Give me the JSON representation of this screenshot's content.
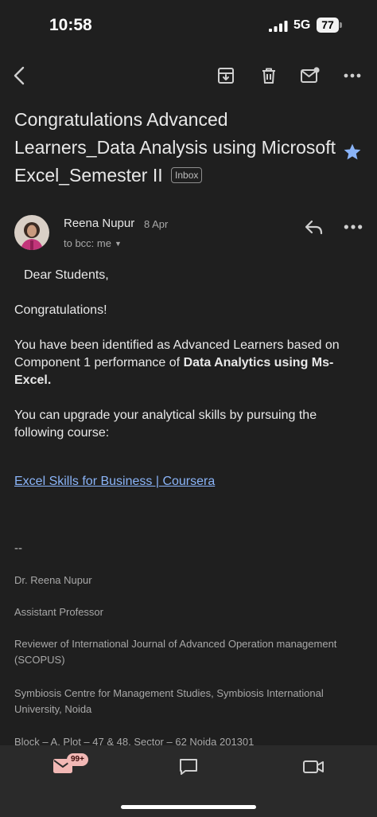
{
  "status_bar": {
    "time": "10:58",
    "network": "5G",
    "battery": "77"
  },
  "toolbar": {
    "back_icon": "chevron-left-icon",
    "archive_icon": "archive-icon",
    "delete_icon": "trash-icon",
    "mark_unread_icon": "mail-unread-icon",
    "more_icon": "more-horizontal-icon"
  },
  "email": {
    "subject": "Congratulations Advanced Learners_Data Analysis using Microsoft Excel_Semester II",
    "label": "Inbox",
    "starred": true,
    "star_color": "#8ab4f8",
    "sender": "Reena Nupur",
    "date": "8 Apr",
    "recipient": "to bcc: me"
  },
  "body": {
    "greeting": "Dear Students,",
    "congrats": "Congratulations!",
    "para1_prefix": "You have been identified as Advanced Learners based on Component 1 performance of ",
    "para1_bold": "Data Analytics using Ms-Excel.",
    "para2": "You can upgrade your analytical skills by pursuing the following course:",
    "link": "Excel Skills for Business | Coursera",
    "link_color": "#8ab4f8"
  },
  "signature": {
    "separator": "--",
    "name": "Dr. Reena Nupur",
    "title": "Assistant Professor",
    "role": "Reviewer of International Journal of Advanced Operation management (SCOPUS)",
    "institution": "Symbiosis Centre for Management Studies, Symbiosis International University, Noida",
    "address": "Block – A, Plot – 47 & 48, Sector – 62 Noida 201301"
  },
  "bottom_nav": {
    "mail_icon": "mail-icon",
    "mail_badge": "99+",
    "chat_icon": "chat-icon",
    "meet_icon": "video-icon",
    "mail_color": "#f2b8b5"
  }
}
